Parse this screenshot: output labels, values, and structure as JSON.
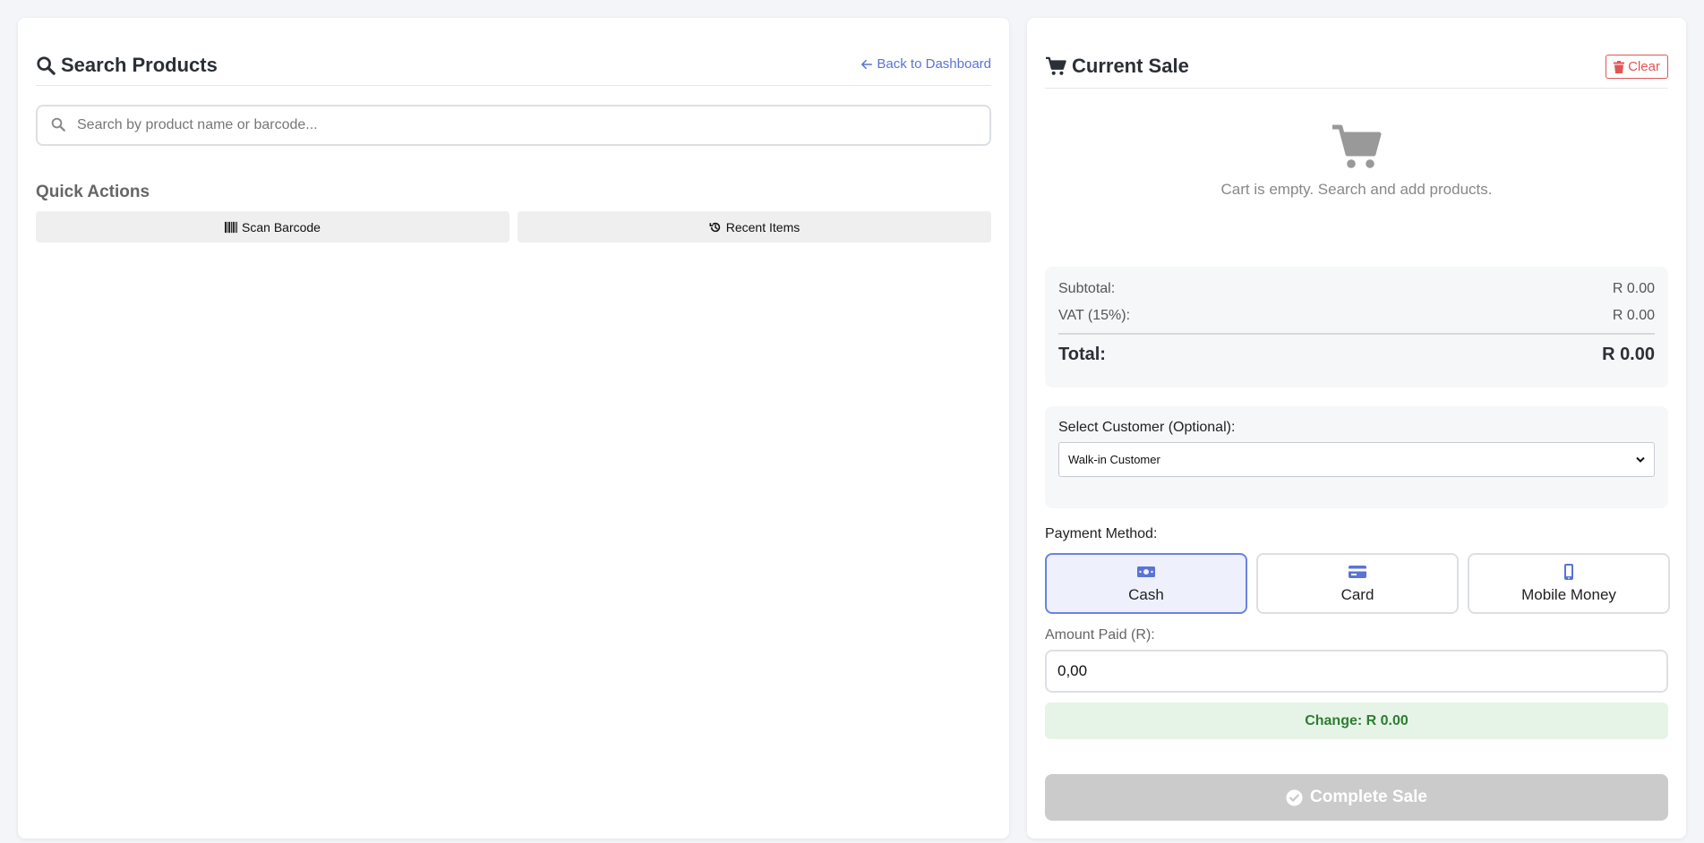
{
  "search_panel": {
    "title": "Search Products",
    "back_link": "Back to Dashboard",
    "search_placeholder": "Search by product name or barcode...",
    "search_value": "",
    "quick_actions": {
      "title": "Quick Actions",
      "scan_barcode": "Scan Barcode",
      "recent_items": "Recent Items"
    }
  },
  "sale_panel": {
    "title": "Current Sale",
    "clear_label": "Clear",
    "empty_message": "Cart is empty. Search and add products.",
    "totals": {
      "subtotal_label": "Subtotal:",
      "subtotal_value": "R 0.00",
      "vat_label": "VAT (15%):",
      "vat_value": "R 0.00",
      "total_label": "Total:",
      "total_value": "R 0.00"
    },
    "customer": {
      "label": "Select Customer (Optional):",
      "selected": "Walk-in Customer"
    },
    "payment": {
      "label": "Payment Method:",
      "methods": [
        {
          "label": "Cash",
          "icon": "money-bill-icon",
          "active": true
        },
        {
          "label": "Card",
          "icon": "credit-card-icon",
          "active": false
        },
        {
          "label": "Mobile Money",
          "icon": "mobile-phone-icon",
          "active": false
        }
      ],
      "amount_label": "Amount Paid (R):",
      "amount_value": "0,00",
      "change_text": "Change: R 0.00"
    },
    "complete_label": "Complete Sale"
  },
  "colors": {
    "accent": "#5b73d6",
    "danger": "#e25555",
    "success_text": "#2e7d32",
    "success_bg": "#e6f4e8",
    "disabled": "#cbcbcb"
  }
}
